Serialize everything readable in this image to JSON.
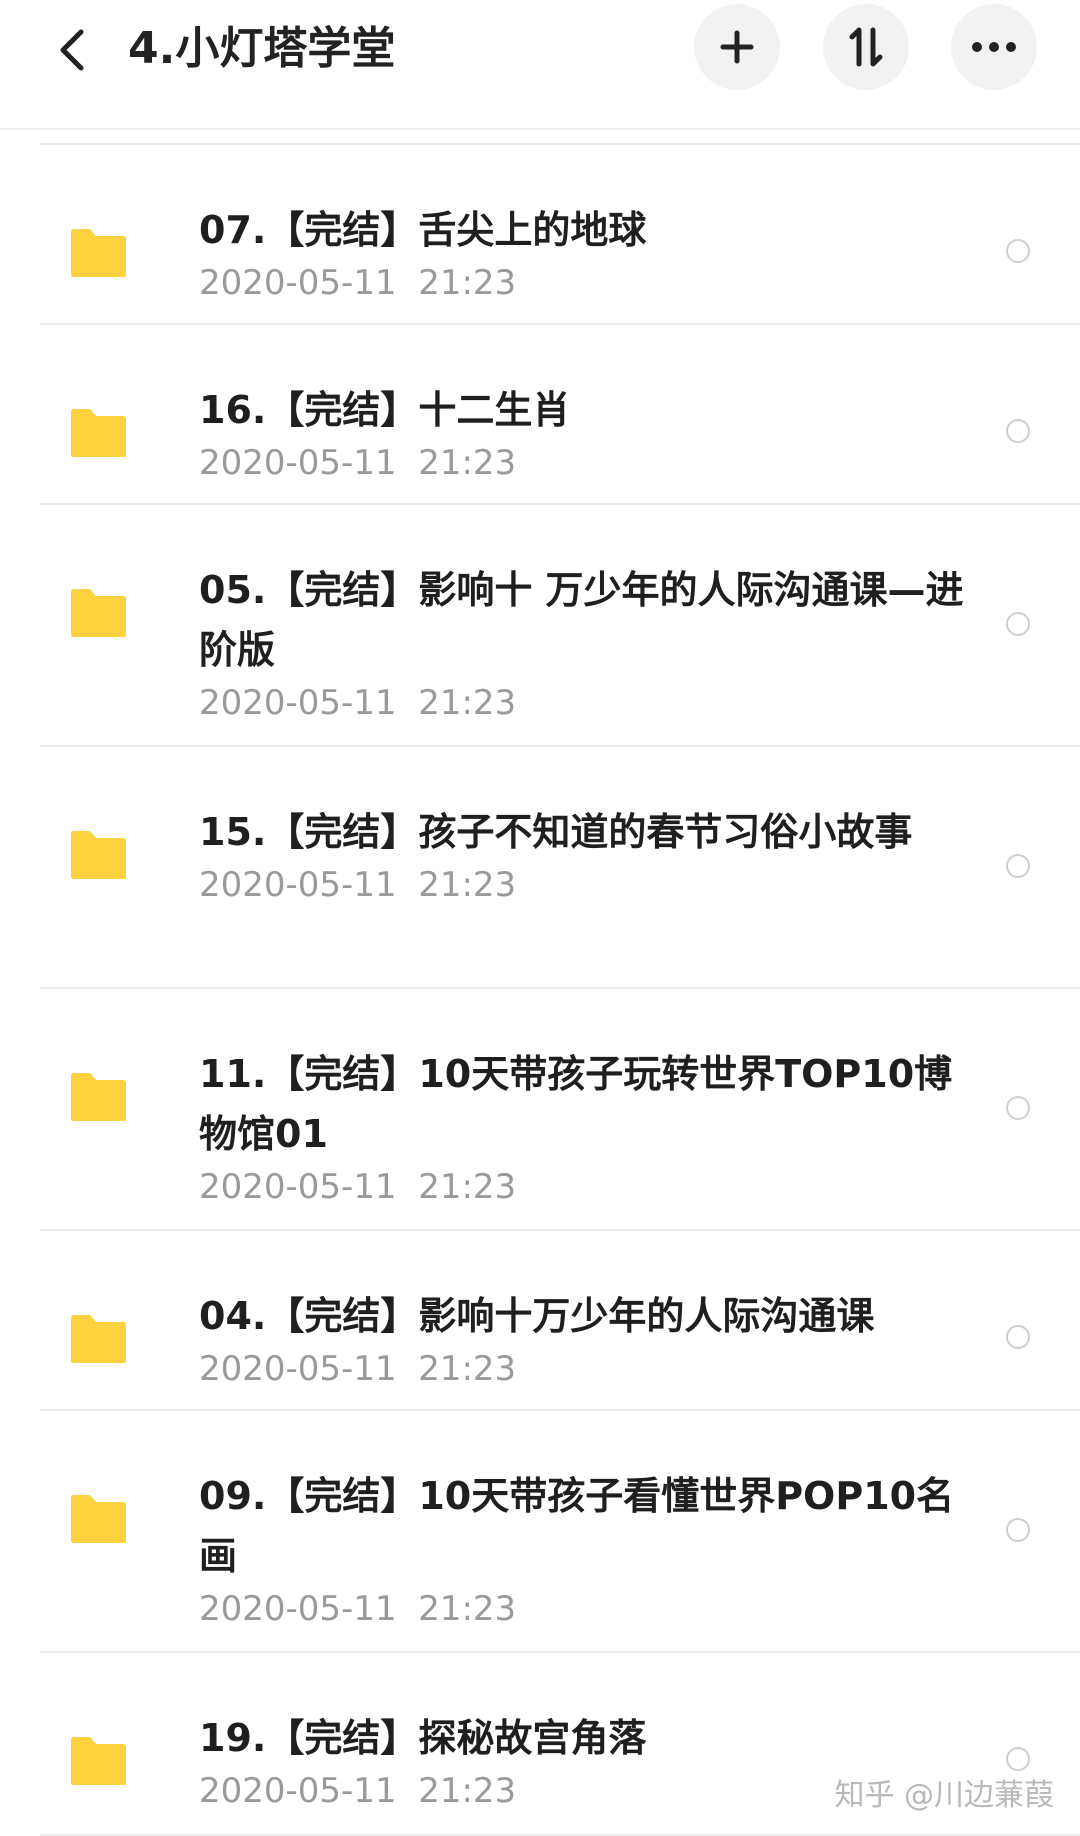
{
  "header": {
    "title": "4.小灯塔学堂",
    "back_icon": "chevron-left-icon",
    "add_icon": "plus-icon",
    "sort_icon": "sort-arrows-icon",
    "more_icon": "more-dots-icon"
  },
  "folder_color": "#FDD23E",
  "items": [
    {
      "title": "07.【完结】舌尖上的地球",
      "date": "2020-05-11  21:23"
    },
    {
      "title": "16.【完结】十二生肖",
      "date": "2020-05-11  21:23"
    },
    {
      "title": "05.【完结】影响十 万少年的人际沟通课—进阶版",
      "date": "2020-05-11  21:23"
    },
    {
      "title": "15.【完结】孩子不知道的春节习俗小故事",
      "date": "2020-05-11  21:23"
    },
    {
      "title": "11.【完结】10天带孩子玩转世界TOP10博物馆01",
      "date": "2020-05-11  21:23"
    },
    {
      "title": "04.【完结】影响十万少年的人际沟通课",
      "date": "2020-05-11  21:23"
    },
    {
      "title": "09.【完结】10天带孩子看懂世界POP10名画",
      "date": "2020-05-11  21:23"
    },
    {
      "title": "19.【完结】探秘故宫角落",
      "date": "2020-05-11  21:23"
    }
  ],
  "watermark": "知乎 @川边蒹葭"
}
